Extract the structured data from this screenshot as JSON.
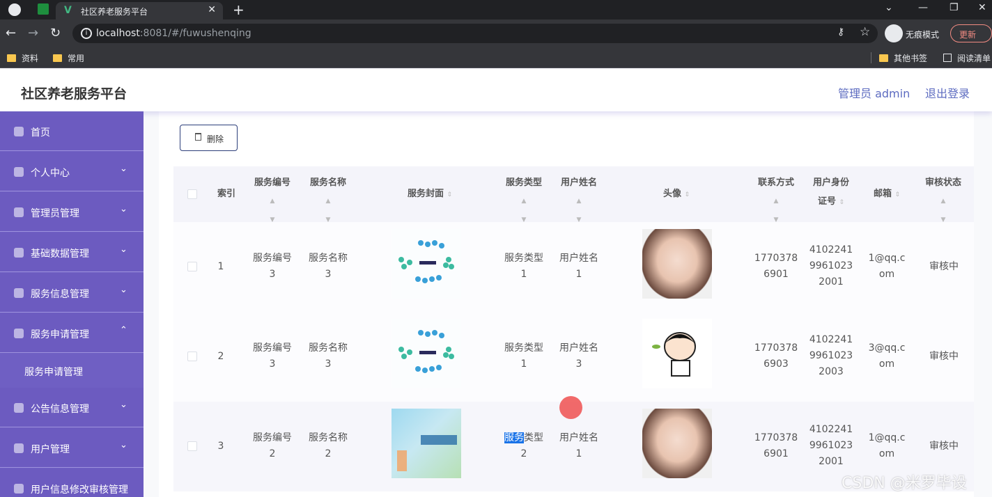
{
  "browser": {
    "tab_title": "社区养老服务平台",
    "url_host": "localhost",
    "url_rest": ":8081/#/fuwushenqing",
    "incognito_label": "无痕模式",
    "update_label": "更新",
    "bookmarks": [
      "资料",
      "常用"
    ],
    "bookmarks_right": [
      "其他书签",
      "阅读清单"
    ]
  },
  "header": {
    "title": "社区养老服务平台",
    "admin": "管理员 admin",
    "logout": "退出登录"
  },
  "sidebar": {
    "items": [
      {
        "label": "首页"
      },
      {
        "label": "个人中心"
      },
      {
        "label": "管理员管理"
      },
      {
        "label": "基础数据管理"
      },
      {
        "label": "服务信息管理"
      },
      {
        "label": "服务申请管理"
      },
      {
        "label": "公告信息管理"
      },
      {
        "label": "用户管理"
      },
      {
        "label": "用户信息修改审核管理"
      }
    ],
    "submenu_label": "服务申请管理"
  },
  "toolbar": {
    "delete_label": "删除"
  },
  "table": {
    "headers": {
      "index": "索引",
      "service_no": "服务编号",
      "service_name": "服务名称",
      "cover": "服务封面",
      "service_type": "服务类型",
      "user_name": "用户姓名",
      "avatar": "头像",
      "contact": "联系方式",
      "id_card_1": "用户身份",
      "id_card_2": "证号",
      "email": "邮箱",
      "status": "审核状态"
    },
    "rows": [
      {
        "index": "1",
        "service_no": [
          "服务编号",
          "3"
        ],
        "service_name": [
          "服务名称",
          "3"
        ],
        "service_type": [
          "服务类型",
          "1"
        ],
        "user_name": [
          "用户姓名",
          "1"
        ],
        "contact": [
          "1770378",
          "6901"
        ],
        "id_card": [
          "4102241",
          "9961023",
          "2001"
        ],
        "email": [
          "1@qq.c",
          "om"
        ],
        "status": "审核中"
      },
      {
        "index": "2",
        "service_no": [
          "服务编号",
          "3"
        ],
        "service_name": [
          "服务名称",
          "3"
        ],
        "service_type": [
          "服务类型",
          "1"
        ],
        "user_name": [
          "用户姓名",
          "3"
        ],
        "contact": [
          "1770378",
          "6903"
        ],
        "id_card": [
          "4102241",
          "9961023",
          "2003"
        ],
        "email": [
          "3@qq.c",
          "om"
        ],
        "status": "审核中"
      },
      {
        "index": "3",
        "service_no": [
          "服务编号",
          "2"
        ],
        "service_name": [
          "服务名称",
          "2"
        ],
        "service_type_hl": "服务",
        "service_type_rest": "类型",
        "service_type_val": "2",
        "user_name": [
          "用户姓名",
          "1"
        ],
        "contact": [
          "1770378",
          "6901"
        ],
        "id_card": [
          "4102241",
          "9961023",
          "2001"
        ],
        "email": [
          "1@qq.c",
          "om"
        ],
        "status": "审核中"
      }
    ]
  },
  "watermark": "CSDN @米罗毕设",
  "colors": {
    "sidebar": "#6c5bc0",
    "header_link": "#5c6bc0",
    "selection": "#1a73e8"
  }
}
